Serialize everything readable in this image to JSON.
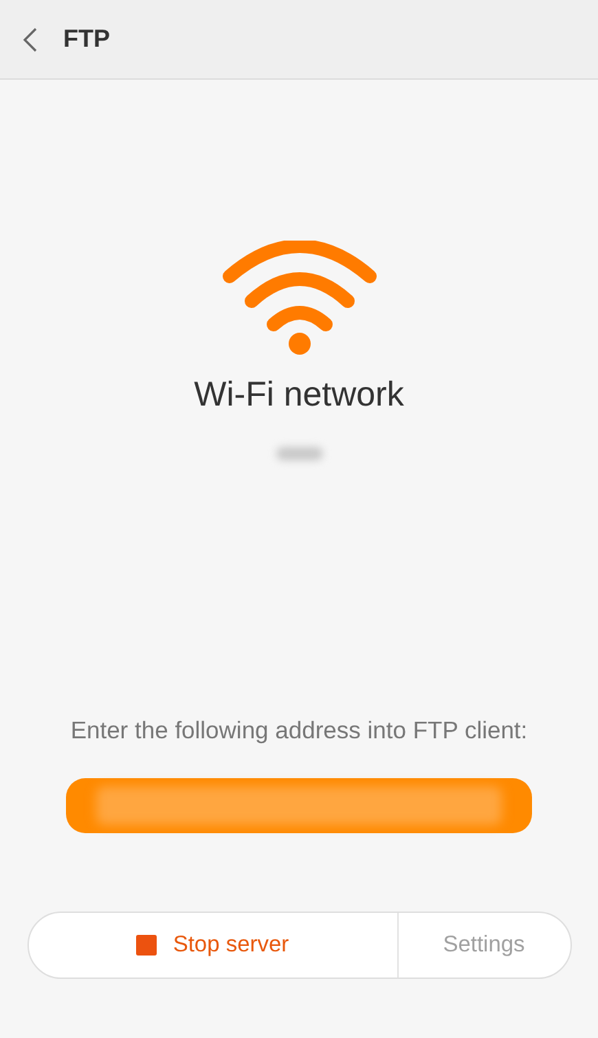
{
  "header": {
    "title": "FTP"
  },
  "network": {
    "label": "Wi-Fi network"
  },
  "instruction": "Enter the following address into FTP client:",
  "buttons": [
    {
      "kind": "stop",
      "label": "Stop server"
    },
    {
      "kind": "plain",
      "label": "Settings"
    }
  ]
}
